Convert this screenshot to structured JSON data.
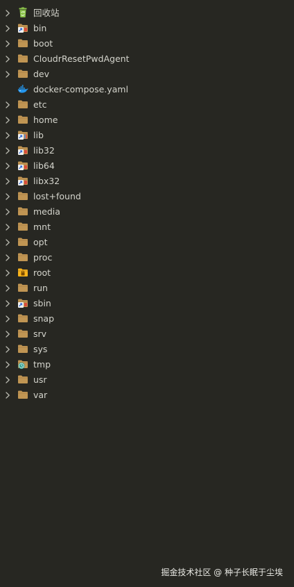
{
  "colors": {
    "background": "#272722",
    "text": "#d4d4cc",
    "chevron": "#b9b9b0",
    "folder": "#c09553",
    "recycle": "#8bc34a",
    "docker": "#2496ed",
    "root_folder": "#f9b31a",
    "tmp_badge": "#2f9e8f",
    "lib_badge": "#5b8dd9"
  },
  "explorer": {
    "items": [
      {
        "label": "回收站",
        "icon": "recycle-bin-icon",
        "chevron": true
      },
      {
        "label": "bin",
        "icon": "folder-symlink-icon",
        "chevron": true
      },
      {
        "label": "boot",
        "icon": "folder-icon",
        "chevron": true
      },
      {
        "label": "CloudrResetPwdAgent",
        "icon": "folder-icon",
        "chevron": true
      },
      {
        "label": "dev",
        "icon": "folder-icon",
        "chevron": true
      },
      {
        "label": "docker-compose.yaml",
        "icon": "docker-icon",
        "chevron": false
      },
      {
        "label": "etc",
        "icon": "folder-icon",
        "chevron": true
      },
      {
        "label": "home",
        "icon": "folder-icon",
        "chevron": true
      },
      {
        "label": "lib",
        "icon": "folder-lib-icon",
        "chevron": true
      },
      {
        "label": "lib32",
        "icon": "folder-symlink-icon",
        "chevron": true
      },
      {
        "label": "lib64",
        "icon": "folder-symlink-icon",
        "chevron": true
      },
      {
        "label": "libx32",
        "icon": "folder-symlink-icon",
        "chevron": true
      },
      {
        "label": "lost+found",
        "icon": "folder-icon",
        "chevron": true
      },
      {
        "label": "media",
        "icon": "folder-icon",
        "chevron": true
      },
      {
        "label": "mnt",
        "icon": "folder-icon",
        "chevron": true
      },
      {
        "label": "opt",
        "icon": "folder-icon",
        "chevron": true
      },
      {
        "label": "proc",
        "icon": "folder-icon",
        "chevron": true
      },
      {
        "label": "root",
        "icon": "folder-root-icon",
        "chevron": true
      },
      {
        "label": "run",
        "icon": "folder-icon",
        "chevron": true
      },
      {
        "label": "sbin",
        "icon": "folder-symlink-icon",
        "chevron": true
      },
      {
        "label": "snap",
        "icon": "folder-icon",
        "chevron": true
      },
      {
        "label": "srv",
        "icon": "folder-icon",
        "chevron": true
      },
      {
        "label": "sys",
        "icon": "folder-icon",
        "chevron": true
      },
      {
        "label": "tmp",
        "icon": "folder-temp-icon",
        "chevron": true
      },
      {
        "label": "usr",
        "icon": "folder-icon",
        "chevron": true
      },
      {
        "label": "var",
        "icon": "folder-icon",
        "chevron": true
      }
    ]
  },
  "watermark": {
    "text": "掘金技术社区 @ 种子长眠于尘埃"
  }
}
